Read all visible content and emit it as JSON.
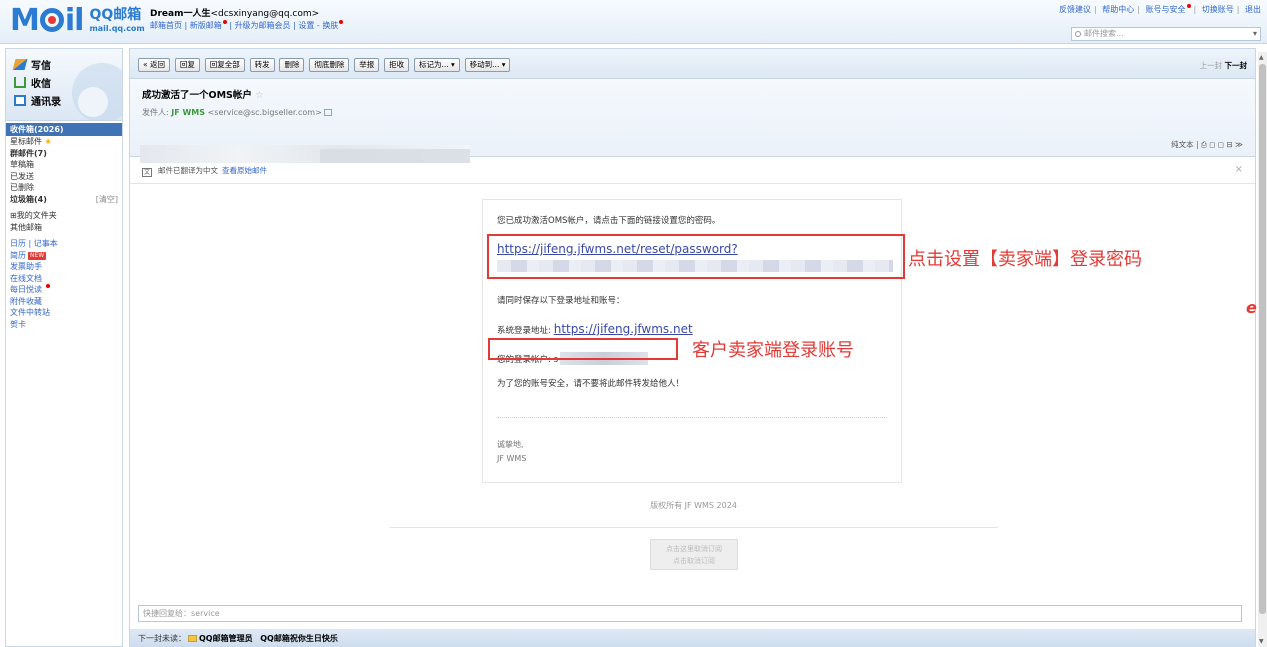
{
  "header": {
    "logo_mail": "Mail",
    "logo_qq": "QQ邮箱",
    "logo_domain": "mail.qq.com",
    "user_name": "Dream一人生",
    "user_email": "<dcsxinyang@qq.com>",
    "user_links": [
      "邮箱首页",
      "新版邮箱",
      "升级为邮箱会员",
      "设置",
      "换肤"
    ],
    "top_links": [
      "反馈建议",
      "帮助中心",
      "账号与安全",
      "切换账号",
      "退出"
    ],
    "search_placeholder": "邮件搜索..."
  },
  "sidebar": {
    "main_links": [
      {
        "label": "写信",
        "icon": "write-icon"
      },
      {
        "label": "收信",
        "icon": "inbox-icon"
      },
      {
        "label": "通讯录",
        "icon": "contacts-icon"
      }
    ],
    "folders": [
      {
        "label": "收件箱(2026)"
      },
      {
        "label": "星标邮件"
      },
      {
        "label": "群邮件(7)"
      },
      {
        "label": "草稿箱"
      },
      {
        "label": "已发送"
      },
      {
        "label": "已删除"
      },
      {
        "label": "垃圾箱(4)",
        "extra": "[清空]"
      }
    ],
    "my_folders": "⊞我的文件夹",
    "other_mailbox": "其他邮箱",
    "tools": [
      "日历 | 记事本",
      "简历",
      "发票助手",
      "在线文档",
      "每日悦读",
      "附件收藏",
      "文件中转站",
      "贺卡"
    ],
    "new_badge": "NEW"
  },
  "toolbar": {
    "buttons": [
      "« 返回",
      "回复",
      "回复全部",
      "转发",
      "删除",
      "彻底删除",
      "举报",
      "拒收",
      "标记为... ▾",
      "移动到... ▾"
    ],
    "pager_prev": "上一封",
    "pager_next": "下一封"
  },
  "email": {
    "subject": "成功激活了一个OMS帐户",
    "sender_label": "发件人:",
    "sender_name": "JF WMS",
    "sender_email": "<service@sc.bigseller.com>",
    "view_options": "纯文本 | ⎙ ◻ ◻ ⊟ ≫",
    "translate_notice": "邮件已翻译为中文",
    "view_original": "查看原始邮件",
    "body_line1": "您已成功激活OMS帐户，请点击下面的链接设置您的密码。",
    "reset_link": "https://jifeng.jfwms.net/reset/password?",
    "body_line2": "请同时保存以下登录地址和账号：",
    "login_label": "系统登录地址:",
    "login_url": "https://jifeng.jfwms.net",
    "account_label": "您的登录帐户: ",
    "account_prefix": "s",
    "body_line3": "为了您的账号安全，请不要将此邮件转发给他人！",
    "sign_off": "诚挚地,",
    "signature": "JF WMS",
    "copyright": "版权所有 JF WMS 2024",
    "unsubscribe_1": "点击这里取消订阅",
    "unsubscribe_2": "点击取消订阅"
  },
  "annotations": {
    "box1_label": "点击设置【卖家端】登录密码",
    "box2_label": "客户卖家端登录账号",
    "color": "#e53935"
  },
  "reply": {
    "placeholder": "快捷回复给：service"
  },
  "bottom": {
    "next_unread": "下一封未读：",
    "item1": "QQ邮箱管理员",
    "item2": "QQ邮箱祝你生日快乐"
  }
}
